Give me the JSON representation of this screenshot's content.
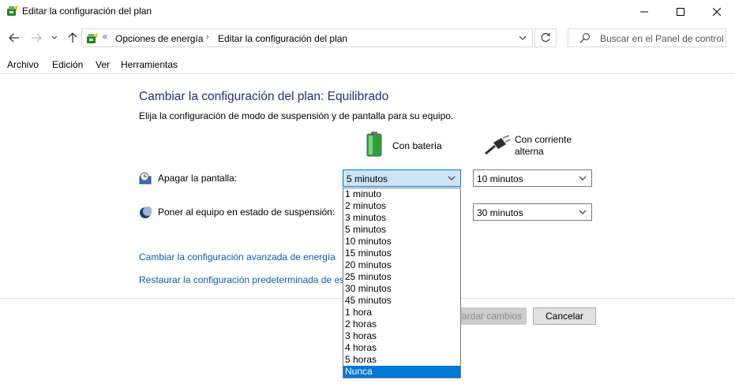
{
  "window": {
    "title": "Editar la configuración del plan",
    "controls": [
      "minimize",
      "maximize",
      "close"
    ]
  },
  "address_bar": {
    "overflow_marker": "«",
    "breadcrumbs": [
      "Opciones de energía",
      "Editar la configuración del plan"
    ],
    "separator": "›",
    "search_placeholder": "Buscar en el Panel de control"
  },
  "menu": {
    "items": [
      "Archivo",
      "Edición",
      "Ver",
      "Herramientas"
    ]
  },
  "main": {
    "title": "Cambiar la configuración del plan: Equilibrado",
    "description": "Elija la configuración de modo de suspensión y de pantalla para su equipo.",
    "columns": {
      "battery": "Con batería",
      "ac": "Con corriente alterna"
    },
    "settings": {
      "display_label": "Apagar la pantalla:",
      "display_battery_value": "5 minutos",
      "display_ac_value": "10 minutos",
      "sleep_label": "Poner al equipo en estado de suspensión:",
      "sleep_ac_value": "30 minutos"
    },
    "links": {
      "advanced": "Cambiar la configuración avanzada de energía",
      "restore": "Restaurar la configuración predeterminada de este plan"
    },
    "buttons": {
      "save": "Guardar cambios",
      "cancel": "Cancelar"
    }
  },
  "dropdown": {
    "options": [
      "1 minuto",
      "2 minutos",
      "3 minutos",
      "5 minutos",
      "10 minutos",
      "15 minutos",
      "20 minutos",
      "25 minutos",
      "30 minutos",
      "45 minutos",
      "1 hora",
      "2 horas",
      "3 horas",
      "4 horas",
      "5 horas",
      "Nunca"
    ],
    "highlighted": "Nunca"
  },
  "colors": {
    "title_blue": "#1e3287",
    "link_blue": "#0a5eaf",
    "highlight": "#0078d7",
    "battery_green": "#3cb043"
  }
}
